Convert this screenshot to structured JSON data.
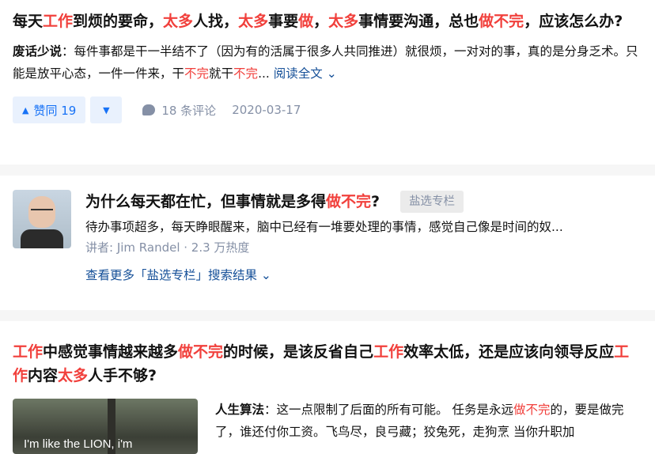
{
  "post1": {
    "title_parts": [
      "每天",
      "工作",
      "到烦的要命，",
      "太多",
      "人找，",
      "太多",
      "事要",
      "做",
      "，",
      "太多",
      "事情要沟通，总也",
      "做不完",
      "，应该怎么办?"
    ],
    "author": "废话少说",
    "excerpt_parts": [
      "：每件事都是干一半结不了（因为有的活属于很多人共同推进）就很烦，一对对的事，真的是分身乏术。只能是放平心态，一件一件来，干",
      "不完",
      "就干",
      "不完",
      "..."
    ],
    "read_more": "阅读全文",
    "read_more_arrow": "⌄",
    "vote_up_icon": "▲",
    "vote_label": "赞同 19",
    "vote_down_icon": "▼",
    "comments": "18 条评论",
    "date": "2020-03-17"
  },
  "post2": {
    "title_parts": [
      "为什么每天都在忙，但事情就是多得",
      "做不完",
      "?"
    ],
    "badge": "盐选专栏",
    "desc": "待办事项超多，每天睁眼醒来，脑中已经有一堆要处理的事情，感觉自己像是时间的奴...",
    "meta": "讲者: Jim Randel · 2.3 万热度",
    "more": "查看更多「盐选专栏」搜索结果 ⌄"
  },
  "post3": {
    "title_parts": [
      "工作",
      "中感觉事情越来越多",
      "做不完",
      "的时候，是该反省自己",
      "工作",
      "效率太低，还是应该向领导反应",
      "工作",
      "内容",
      "太多",
      "人手不够?"
    ],
    "image_caption": "I'm like the LION, i'm",
    "author": "人生算法",
    "excerpt_parts": [
      "：这一点限制了后面的所有可能。 任务是永远",
      "做不完",
      "的，要是做完了，谁还付你工资。飞鸟尽，良弓藏；狡兔死，走狗烹 当你升职加"
    ]
  },
  "colors": {
    "highlight": "#f1403c",
    "link": "#175199",
    "vote_bg": "#e9f1fd",
    "vote_fg": "#1772f6",
    "meta": "#8590a6"
  }
}
